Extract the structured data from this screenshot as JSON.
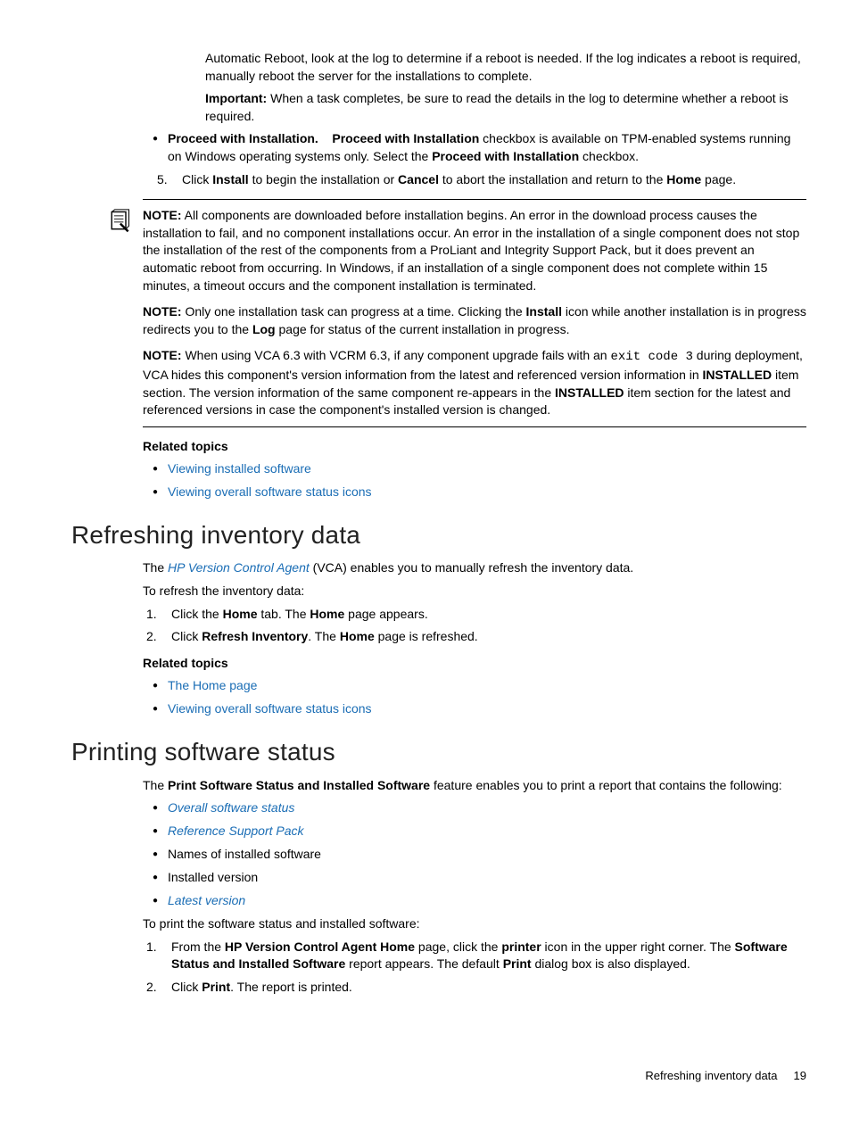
{
  "intro": {
    "para1": "Automatic Reboot, look at the log to determine if a reboot is needed. If the log indicates a reboot is required, manually reboot the server for the installations to complete.",
    "important_label": "Important:",
    "important_text": " When a task completes, be sure to read the details in the log to determine whether a reboot is required."
  },
  "proceed": {
    "lead_bold": "Proceed with Installation.",
    "mid_bold": "Proceed with Installation",
    "mid_text": " checkbox is available on TPM-enabled systems running on Windows operating systems only. Select the ",
    "tail_bold": "Proceed with Installation",
    "tail_text": " checkbox."
  },
  "step5": {
    "num": "5.",
    "t1": "Click ",
    "b1": "Install",
    "t2": " to begin the installation or ",
    "b2": "Cancel",
    "t3": " to abort the installation and return to the ",
    "b3": "Home",
    "t4": " page."
  },
  "notes": {
    "n1": {
      "label": "NOTE:",
      "text": "   All components are downloaded before installation begins. An error in the download process causes the installation to fail, and no component installations occur. An error in the installation of a single component does not stop the installation of the rest of the components from a ProLiant and Integrity Support Pack, but it does prevent an automatic reboot from occurring. In Windows, if an installation of a single component does not complete within 15 minutes, a timeout occurs and the component installation is terminated."
    },
    "n2": {
      "label": "NOTE:",
      "t1": "   Only one installation task can progress at a time. Clicking the ",
      "b1": "Install",
      "t2": " icon while another installation is in progress redirects you to the ",
      "b2": "Log",
      "t3": " page for status of the current installation in progress."
    },
    "n3": {
      "label": "NOTE:",
      "t1": "   When using VCA 6.3 with VCRM 6.3, if any component upgrade fails with an ",
      "code": "exit code 3",
      "t2": " during deployment, VCA hides this component's version information from the latest and referenced version information in ",
      "b1": "INSTALLED",
      "t3": " item section. The version information of the same component re-appears in the ",
      "b2": "INSTALLED",
      "t4": " item section for the latest and referenced versions in case the component's installed version is changed."
    }
  },
  "related1": {
    "heading": "Related topics",
    "items": [
      "Viewing installed software",
      "Viewing overall software status icons"
    ]
  },
  "refresh": {
    "title": "Refreshing inventory data",
    "p1a": "The ",
    "p1_link": "HP Version Control Agent",
    "p1b": " (VCA) enables you to manually refresh the inventory data.",
    "p2": "To refresh the inventory data:",
    "s1": {
      "num": "1.",
      "t1": "Click the ",
      "b1": "Home",
      "t2": " tab. The ",
      "b2": "Home",
      "t3": " page appears."
    },
    "s2": {
      "num": "2.",
      "t1": "Click ",
      "b1": "Refresh Inventory",
      "t2": ". The ",
      "b2": "Home",
      "t3": " page is refreshed."
    }
  },
  "related2": {
    "heading": "Related topics",
    "items": [
      "The Home page",
      "Viewing overall software status icons"
    ]
  },
  "print": {
    "title": "Printing software status",
    "p1a": "The ",
    "p1_bold": "Print Software Status and Installed Software",
    "p1b": " feature enables you to print a report that contains the following:",
    "bullets": {
      "i1": "Overall software status",
      "i2": "Reference Support Pack",
      "i3": "Names of installed software",
      "i4": "Installed version",
      "i5": "Latest version"
    },
    "p2": "To print the software status and installed software:",
    "s1": {
      "num": "1.",
      "t1": "From the ",
      "b1": "HP Version Control Agent Home",
      "t2": " page, click the ",
      "b2": "printer",
      "t3": " icon in the upper right corner. The ",
      "b3": "Software Status and Installed Software",
      "t4": " report appears. The default ",
      "b4": "Print",
      "t5": " dialog box is also displayed."
    },
    "s2": {
      "num": "2.",
      "t1": "Click ",
      "b1": "Print",
      "t2": ". The report is printed."
    }
  },
  "footer": {
    "text": "Refreshing inventory data",
    "page": "19"
  }
}
